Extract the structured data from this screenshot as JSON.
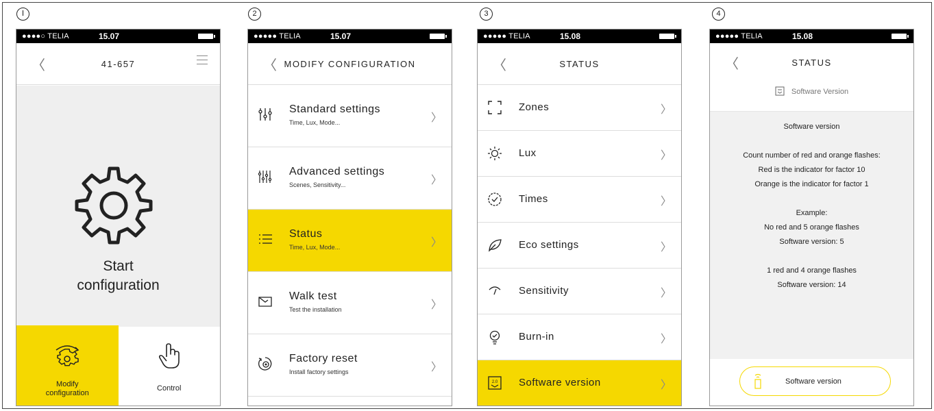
{
  "steps": [
    "Ⅰ",
    "2",
    "3",
    "4"
  ],
  "status_bar": {
    "p1": {
      "carrier": "●●●●○ TELIA",
      "time": "15.07"
    },
    "p2": {
      "carrier": "●●●●● TELIA",
      "time": "15.07"
    },
    "p3": {
      "carrier": "●●●●● TELIA",
      "time": "15.08"
    },
    "p4": {
      "carrier": "●●●●● TELIA",
      "time": "15.08"
    }
  },
  "phone1": {
    "title": "41-657",
    "start_label_line1": "Start",
    "start_label_line2": "configuration",
    "tabs": [
      {
        "line1": "Modify",
        "line2": "configuration",
        "icon": "modify-config-icon"
      },
      {
        "line1": "Control",
        "line2": "",
        "icon": "hand-pointer-icon"
      }
    ]
  },
  "phone2": {
    "title": "MODIFY CONFIGURATION",
    "items": [
      {
        "title": "Standard settings",
        "subtitle": "Time, Lux, Mode...",
        "icon": "sliders-icon"
      },
      {
        "title": "Advanced settings",
        "subtitle": "Scenes, Sensitivity...",
        "icon": "advanced-sliders-icon"
      },
      {
        "title": "Status",
        "subtitle": "Time, Lux, Mode...",
        "icon": "list-icon"
      },
      {
        "title": "Walk test",
        "subtitle": "Test the installation",
        "icon": "walk-test-icon"
      },
      {
        "title": "Factory reset",
        "subtitle": "Install factory settings",
        "icon": "reset-icon"
      }
    ]
  },
  "phone3": {
    "title": "STATUS",
    "items": [
      {
        "title": "Zones",
        "icon": "zones-icon"
      },
      {
        "title": "Lux",
        "icon": "sun-icon"
      },
      {
        "title": "Times",
        "icon": "clock-icon"
      },
      {
        "title": "Eco settings",
        "icon": "leaf-icon"
      },
      {
        "title": "Sensitivity",
        "icon": "sensitivity-icon"
      },
      {
        "title": "Burn-in",
        "icon": "bulb-icon"
      },
      {
        "title": "Software version",
        "icon": "software-icon",
        "chip_text": "2.0"
      }
    ]
  },
  "phone4": {
    "title": "STATUS",
    "subtitle": "Software Version",
    "lines": [
      "Software version",
      "",
      "Count number of red and orange flashes:",
      "Red is the indicator for factor 10",
      "Orange is the indicator for factor 1",
      "",
      "Example:",
      "No red and 5 orange flashes",
      "Software version: 5",
      "",
      "1 red and 4 orange flashes",
      "Software version: 14"
    ],
    "button": "Software version"
  },
  "colors": {
    "accent": "#f5d800",
    "panel_bg": "#efefef",
    "text": "#222222"
  }
}
